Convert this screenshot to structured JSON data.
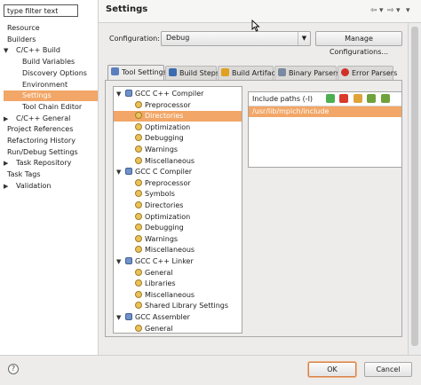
{
  "filter": {
    "value": "type filter text"
  },
  "nav": {
    "items": [
      {
        "label": "Resource",
        "expander": ""
      },
      {
        "label": "Builders",
        "expander": ""
      },
      {
        "label": "C/C++ Build",
        "expander": "▼"
      },
      {
        "label": "Build Variables",
        "expander": ""
      },
      {
        "label": "Discovery Options",
        "expander": ""
      },
      {
        "label": "Environment",
        "expander": ""
      },
      {
        "label": "Settings",
        "expander": ""
      },
      {
        "label": "Tool Chain Editor",
        "expander": ""
      },
      {
        "label": "C/C++ General",
        "expander": "▶"
      },
      {
        "label": "Project References",
        "expander": ""
      },
      {
        "label": "Refactoring History",
        "expander": ""
      },
      {
        "label": "Run/Debug Settings",
        "expander": ""
      },
      {
        "label": "Task Repository",
        "expander": "▶"
      },
      {
        "label": "Task Tags",
        "expander": ""
      },
      {
        "label": "Validation",
        "expander": "▶"
      }
    ],
    "selected": "Settings"
  },
  "header": {
    "title": "Settings",
    "nav_glyphs": [
      "⇦",
      "▾",
      "⇨",
      "▾",
      "▾"
    ]
  },
  "configuration": {
    "label": "Configuration:",
    "value": "Debug",
    "manage_button": "Manage Configurations..."
  },
  "tabs": [
    {
      "label": "Tool Settings",
      "icon": "tool-settings-icon",
      "color": "#5a7fbf"
    },
    {
      "label": "Build Steps",
      "icon": "build-steps-icon",
      "color": "#3d6bb0"
    },
    {
      "label": "Build Artifact",
      "icon": "build-artifact-icon",
      "color": "#e0a020"
    },
    {
      "label": "Binary Parsers",
      "icon": "binary-parsers-icon",
      "color": "#7a8aa0"
    },
    {
      "label": "Error Parsers",
      "icon": "error-parsers-icon",
      "color": "#d0302a"
    }
  ],
  "tree": {
    "rows": [
      {
        "label": "GCC C++ Compiler",
        "level": 0,
        "icon": "tool"
      },
      {
        "label": "Preprocessor",
        "level": 1,
        "icon": "gear"
      },
      {
        "label": "Directories",
        "level": 1,
        "icon": "gear"
      },
      {
        "label": "Optimization",
        "level": 1,
        "icon": "gear"
      },
      {
        "label": "Debugging",
        "level": 1,
        "icon": "gear"
      },
      {
        "label": "Warnings",
        "level": 1,
        "icon": "gear"
      },
      {
        "label": "Miscellaneous",
        "level": 1,
        "icon": "gear"
      },
      {
        "label": "GCC C Compiler",
        "level": 0,
        "icon": "tool"
      },
      {
        "label": "Preprocessor",
        "level": 1,
        "icon": "gear"
      },
      {
        "label": "Symbols",
        "level": 1,
        "icon": "gear"
      },
      {
        "label": "Directories",
        "level": 1,
        "icon": "gear"
      },
      {
        "label": "Optimization",
        "level": 1,
        "icon": "gear"
      },
      {
        "label": "Debugging",
        "level": 1,
        "icon": "gear"
      },
      {
        "label": "Warnings",
        "level": 1,
        "icon": "gear"
      },
      {
        "label": "Miscellaneous",
        "level": 1,
        "icon": "gear"
      },
      {
        "label": "GCC C++ Linker",
        "level": 0,
        "icon": "tool"
      },
      {
        "label": "General",
        "level": 1,
        "icon": "gear"
      },
      {
        "label": "Libraries",
        "level": 1,
        "icon": "gear"
      },
      {
        "label": "Miscellaneous",
        "level": 1,
        "icon": "gear"
      },
      {
        "label": "Shared Library Settings",
        "level": 1,
        "icon": "gear"
      },
      {
        "label": "GCC Assembler",
        "level": 0,
        "icon": "tool"
      },
      {
        "label": "General",
        "level": 1,
        "icon": "gear"
      }
    ],
    "selected_index": 2
  },
  "include_paths": {
    "header": "Include paths (-I)",
    "items": [
      "/usr/lib/mpich/include"
    ],
    "toolbar_icons": [
      {
        "name": "add-path-icon",
        "color": "#4caf50"
      },
      {
        "name": "delete-path-icon",
        "color": "#d93a2b"
      },
      {
        "name": "edit-path-icon",
        "color": "#e0a33a"
      },
      {
        "name": "move-up-icon",
        "color": "#6fa23a"
      },
      {
        "name": "move-down-icon",
        "color": "#6fa23a"
      }
    ]
  },
  "footer": {
    "help_glyph": "?",
    "ok_label": "OK",
    "cancel_label": "Cancel"
  },
  "colors": {
    "selection": "#f2a667",
    "accent_border": "#d5804a"
  }
}
